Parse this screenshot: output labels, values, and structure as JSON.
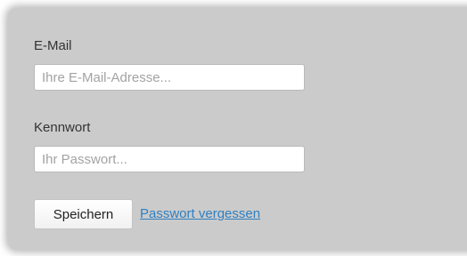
{
  "form": {
    "email_label": "E-Mail",
    "email_placeholder": "Ihre E-Mail-Adresse...",
    "email_value": "",
    "password_label": "Kennwort",
    "password_placeholder": "Ihr Passwort...",
    "password_value": "",
    "save_label": "Speichern",
    "forgot_label": "Passwort vergessen"
  },
  "colors": {
    "panel_bg": "#cbcbcb",
    "link": "#2f7fc1"
  }
}
